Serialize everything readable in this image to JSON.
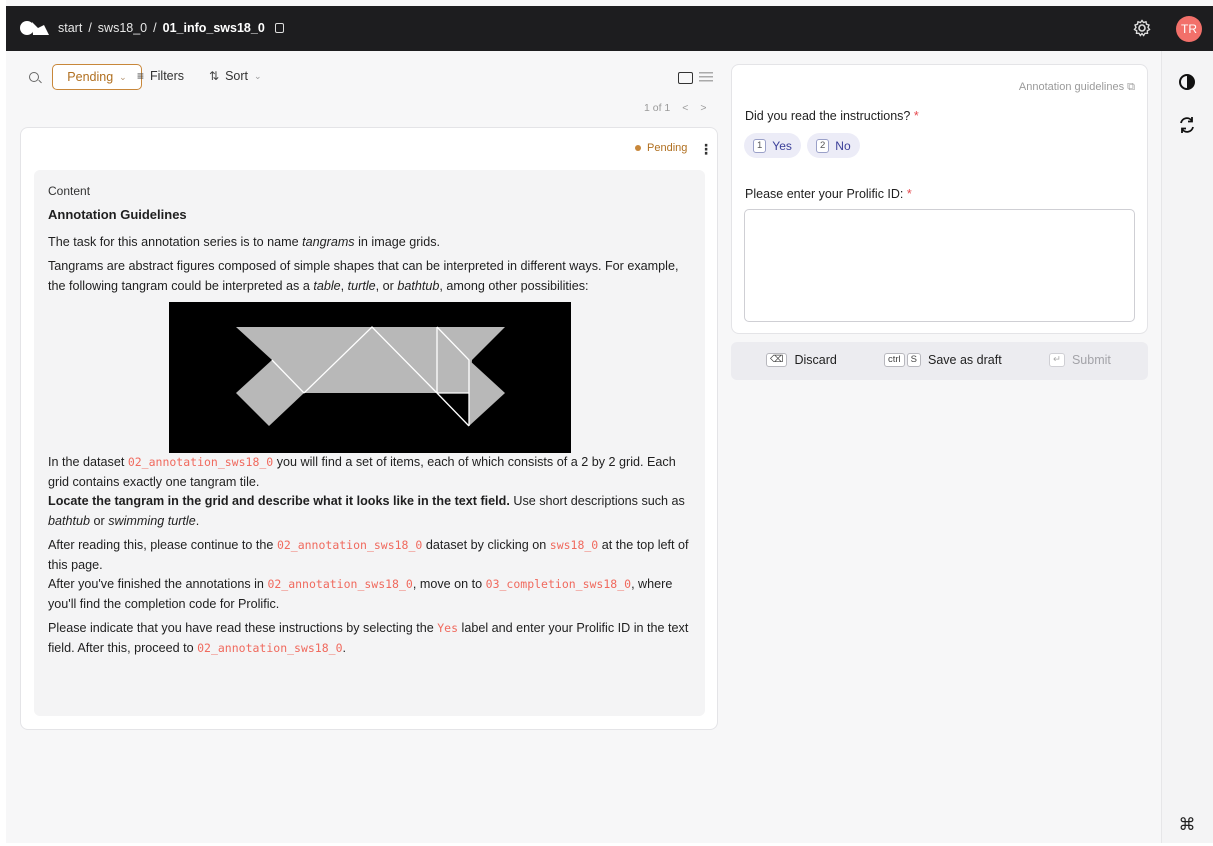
{
  "header": {
    "breadcrumbs": [
      "start",
      "sws18_0",
      "01_info_sws18_0"
    ],
    "separator": "/",
    "avatar_initials": "TR"
  },
  "toolbar": {
    "status_filter": "Pending",
    "filters_label": "Filters",
    "sort_label": "Sort"
  },
  "pagination": {
    "text": "1 of 1"
  },
  "record": {
    "status": "Pending",
    "field_label": "Content",
    "guidelines_heading": "Annotation Guidelines",
    "p1_a": "The task for this annotation series is to name ",
    "p1_em": "tangrams",
    "p1_b": " in image grids.",
    "p2_a": "Tangrams are abstract figures composed of simple shapes that can be interpreted in different ways. For example, the following tangram could be interpreted as a ",
    "p2_em1": "table",
    "p2_sep1": ", ",
    "p2_em2": "turtle",
    "p2_sep2": ", or ",
    "p2_em3": "bathtub",
    "p2_b": ", among other possibilities:",
    "p3_a": "In the dataset ",
    "p3_code": "02_annotation_sws18_0",
    "p3_b": " you will find a set of items, each of which consists of a 2 by 2 grid. Each grid contains exactly one tangram tile.",
    "p3_bold": "Locate the tangram in the grid and describe what it looks like in the text field.",
    "p3_c": " Use short descriptions such as ",
    "p3_em1": "bathtub",
    "p3_d": " or ",
    "p3_em2": "swimming turtle",
    "p3_e": ".",
    "p4_a": "After reading this, please continue to the ",
    "p4_code1": "02_annotation_sws18_0",
    "p4_b": " dataset by clicking on ",
    "p4_code2": "sws18_0",
    "p4_c": " at the top left of this page.",
    "p4_d": "After you've finished the annotations in ",
    "p4_code3": "02_annotation_sws18_0",
    "p4_e": ", move on to ",
    "p4_code4": "03_completion_sws18_0",
    "p4_f": ", where you'll find the completion code for Prolific.",
    "p5_a": "Please indicate that you have read these instructions by selecting the ",
    "p5_code1": "Yes",
    "p5_b": " label and enter your Prolific ID in the text field. After this, proceed to ",
    "p5_code2": "02_annotation_sws18_0",
    "p5_c": "."
  },
  "form": {
    "guidelines_link": "Annotation guidelines",
    "q1_label": "Did you read the instructions?",
    "required_mark": "*",
    "options": [
      {
        "key": "1",
        "label": "Yes"
      },
      {
        "key": "2",
        "label": "No"
      }
    ],
    "q2_label": "Please enter your Prolific ID:",
    "prolific_id_value": ""
  },
  "actions": {
    "discard_key": "⌫",
    "discard_label": "Discard",
    "save_keys": [
      "ctrl",
      "S"
    ],
    "save_label": "Save as draft",
    "submit_key": "↵",
    "submit_label": "Submit"
  },
  "icons": {
    "logo": "argilla-logo-icon",
    "settings": "gear-icon",
    "theme": "contrast-icon",
    "refresh": "refresh-icon",
    "command": "command-icon"
  },
  "colors": {
    "topbar": "#1d1d1f",
    "pending": "#c8873a",
    "code": "#f06a5e",
    "avatar": "#f2706a",
    "option_bg": "#ececf7",
    "required": "#e5484d"
  }
}
